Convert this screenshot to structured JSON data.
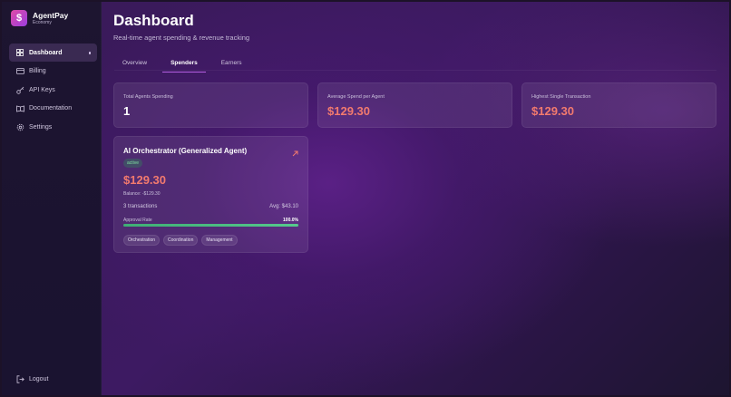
{
  "brand": {
    "name": "AgentPay",
    "subtitle": "Economy"
  },
  "nav": [
    {
      "label": "Dashboard",
      "icon": "dashboard-icon",
      "active": true
    },
    {
      "label": "Billing",
      "icon": "credit-card-icon"
    },
    {
      "label": "API Keys",
      "icon": "key-icon"
    },
    {
      "label": "Documentation",
      "icon": "book-icon"
    },
    {
      "label": "Settings",
      "icon": "gear-icon"
    }
  ],
  "logout_label": "Logout",
  "page": {
    "title": "Dashboard",
    "subtitle": "Real-time agent spending & revenue tracking"
  },
  "tabs": [
    {
      "label": "Overview"
    },
    {
      "label": "Spenders",
      "active": true
    },
    {
      "label": "Earners"
    }
  ],
  "stats": [
    {
      "label": "Total Agents Spending",
      "value": "1"
    },
    {
      "label": "Average Spend per Agent",
      "value": "$129.30"
    },
    {
      "label": "Highest Single Transaction",
      "value": "$129.30"
    }
  ],
  "agent_card": {
    "name": "AI Orchestrator (Generalized Agent)",
    "status": "active",
    "spend": "$129.30",
    "balance": "Balance: -$129.30",
    "transactions": "3 transactions",
    "average": "Avg: $43.10",
    "approval_label": "Approval Rate",
    "approval_value": "100.0%",
    "approval_fraction": 1.0,
    "tags": [
      "Orchestration",
      "Coordination",
      "Management"
    ]
  },
  "colors": {
    "accent": "#b35ee0",
    "money": "#f27a6e",
    "success": "#56c98d"
  }
}
